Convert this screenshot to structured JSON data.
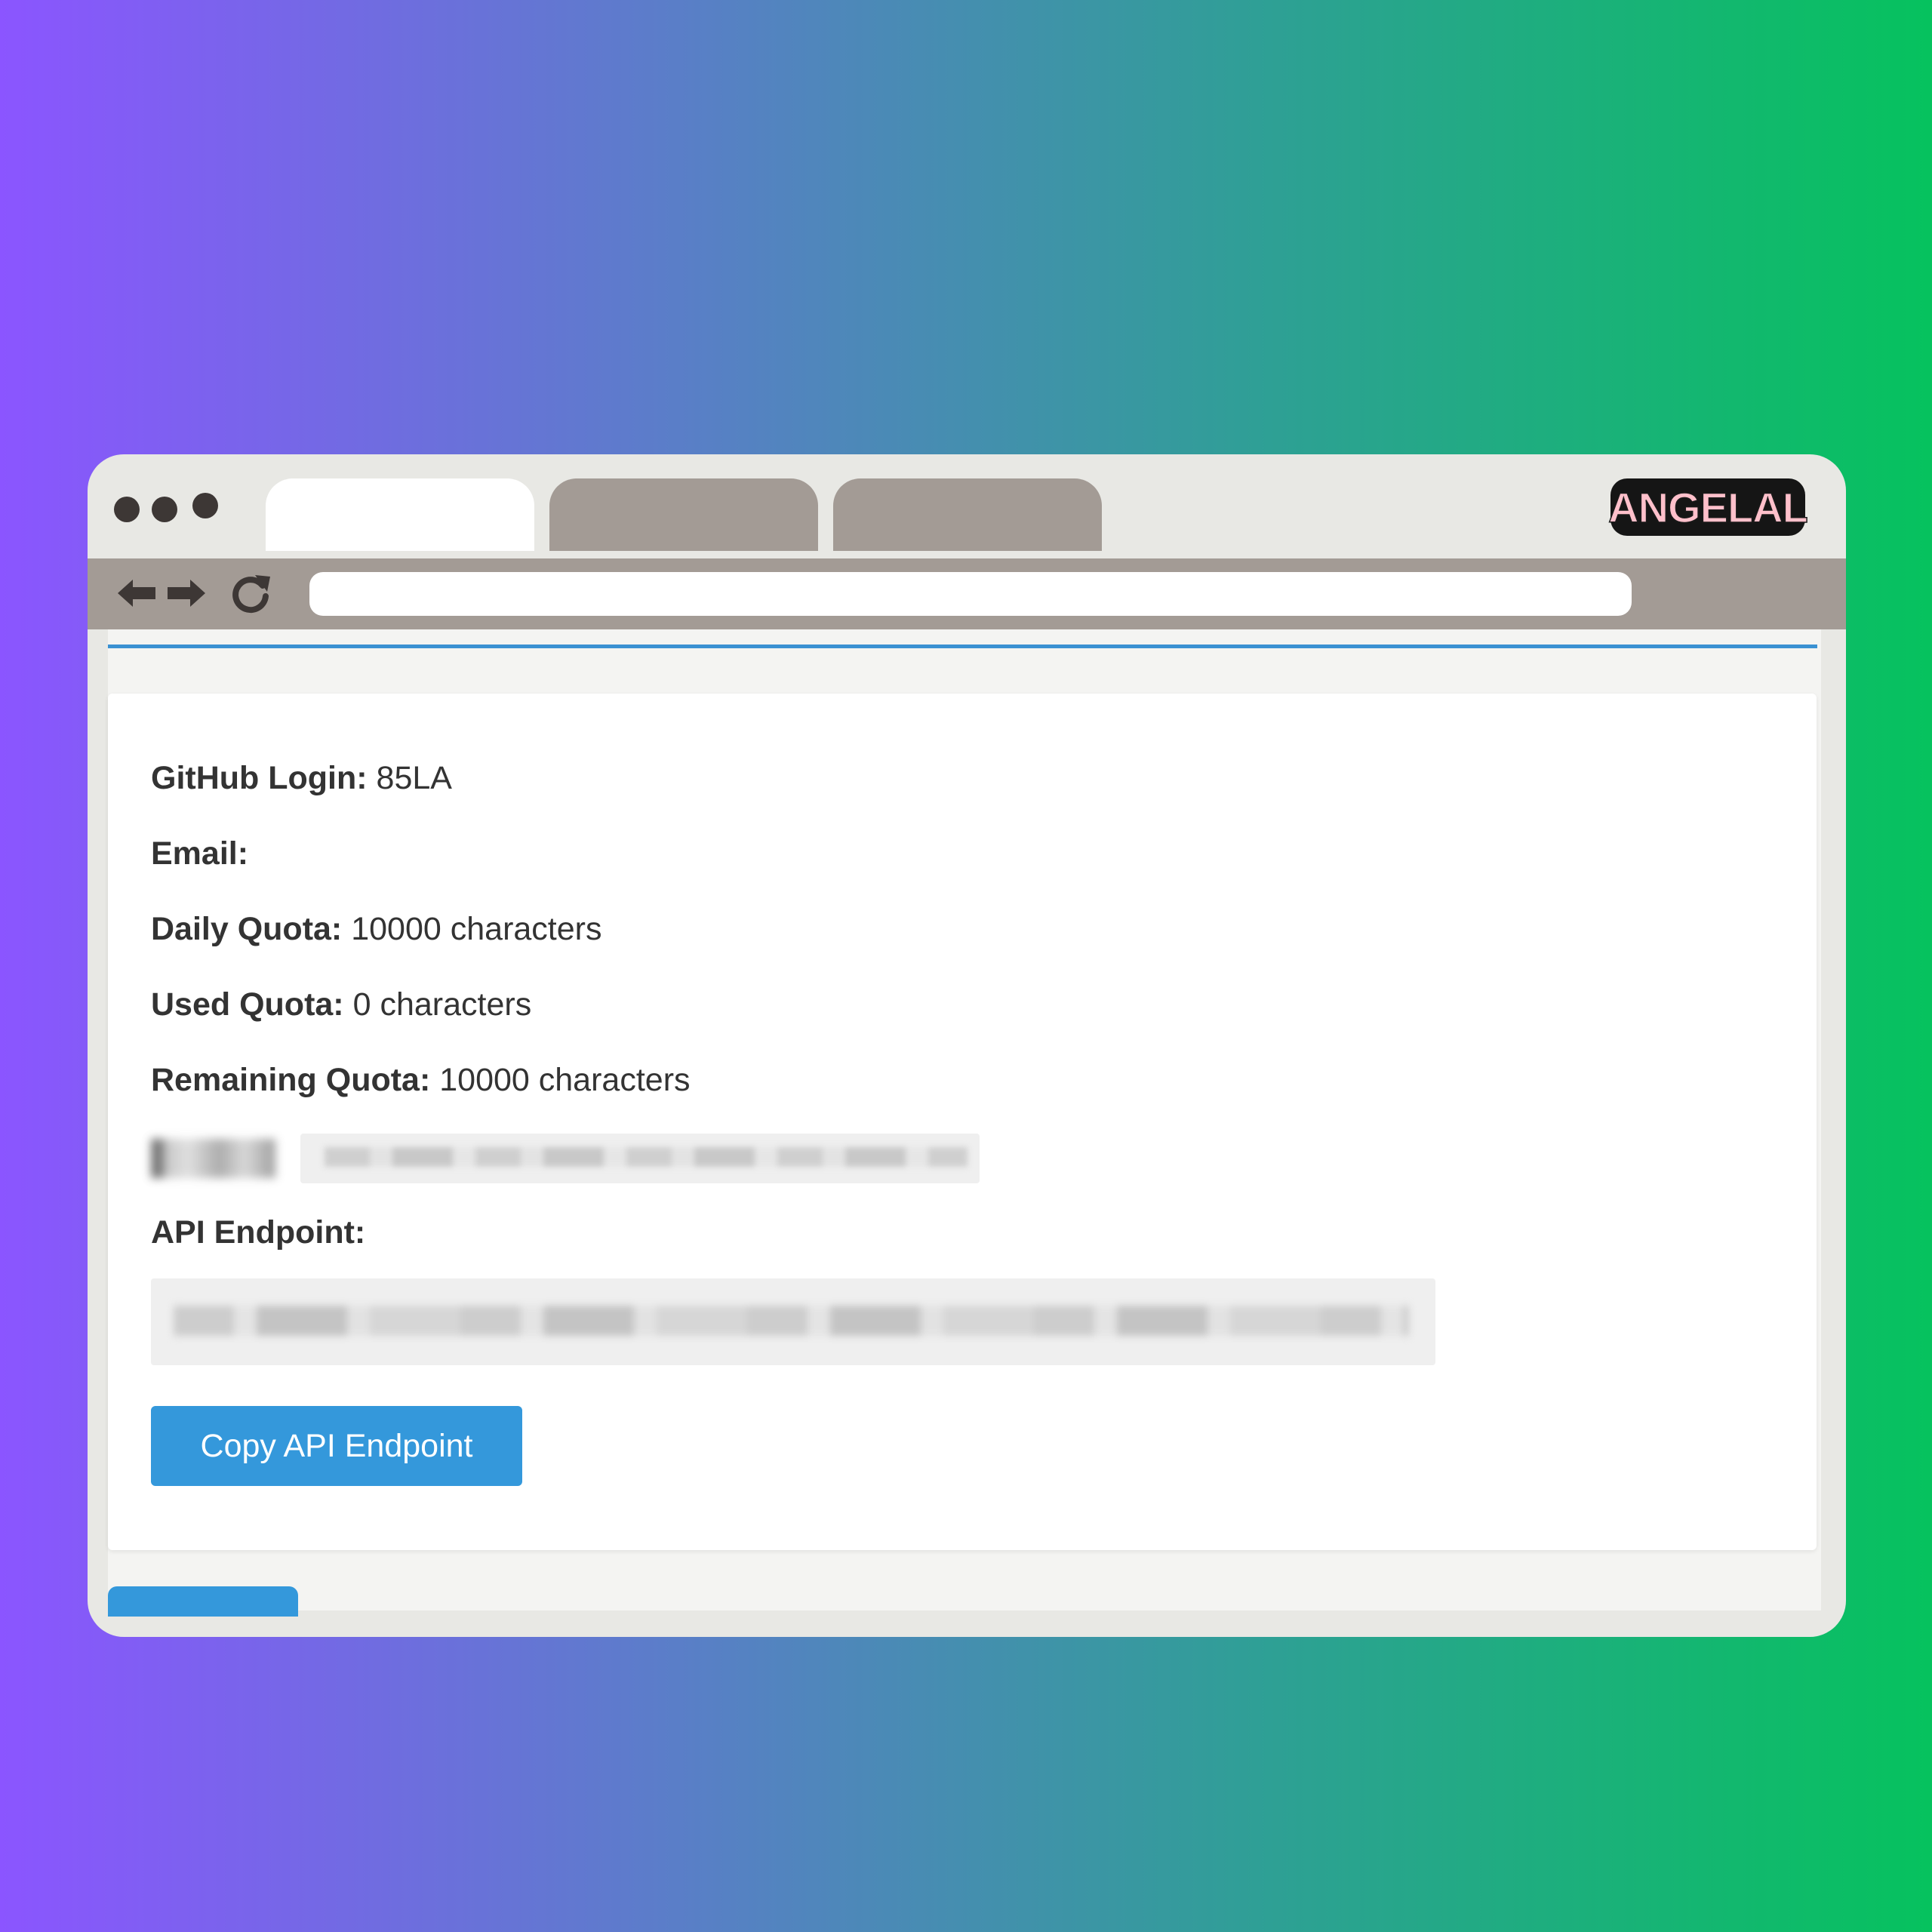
{
  "browser": {
    "brand": "ANGELAL",
    "colors": {
      "accent": "#3498db",
      "chrome": "#a39b95",
      "badge_text": "#ffc0cb"
    },
    "nav_icons": [
      "arrow-left-icon",
      "arrow-right-icon",
      "reload-icon"
    ]
  },
  "account": {
    "github_login_label": "GitHub Login:",
    "github_login_value": "85LA",
    "email_label": "Email:",
    "email_value": "",
    "daily_quota_label": "Daily Quota:",
    "daily_quota_value": "10000 characters",
    "used_quota_label": "Used Quota:",
    "used_quota_value": "0 characters",
    "remaining_quota_label": "Remaining Quota:",
    "remaining_quota_value": "10000 characters",
    "api_endpoint_label": "API Endpoint:",
    "copy_button_label": "Copy API Endpoint"
  }
}
